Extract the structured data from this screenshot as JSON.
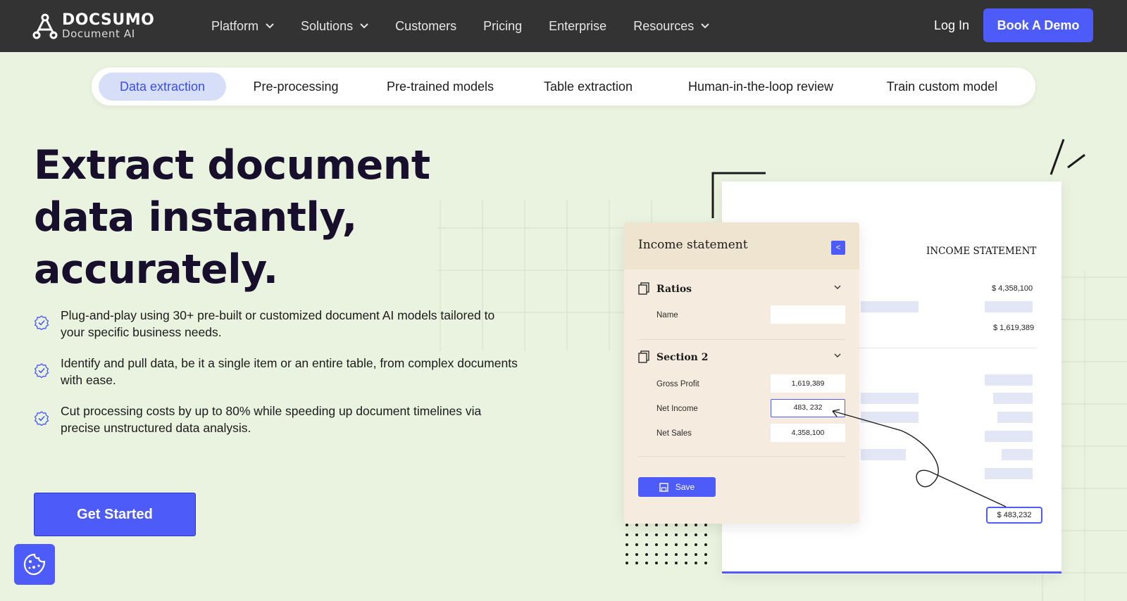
{
  "brand": {
    "name": "DOCSUMO",
    "subtitle": "Document AI"
  },
  "nav": {
    "items": [
      {
        "label": "Platform",
        "has_dropdown": true
      },
      {
        "label": "Solutions",
        "has_dropdown": true
      },
      {
        "label": "Customers",
        "has_dropdown": false
      },
      {
        "label": "Pricing",
        "has_dropdown": false
      },
      {
        "label": "Enterprise",
        "has_dropdown": false
      },
      {
        "label": "Resources",
        "has_dropdown": true
      }
    ],
    "login_label": "Log In",
    "demo_label": "Book A Demo"
  },
  "tabs": [
    {
      "label": "Data extraction",
      "active": true
    },
    {
      "label": "Pre-processing",
      "active": false
    },
    {
      "label": "Pre-trained models",
      "active": false
    },
    {
      "label": "Table extraction",
      "active": false
    },
    {
      "label": "Human-in-the-loop review",
      "active": false
    },
    {
      "label": "Train custom model",
      "active": false
    }
  ],
  "hero": {
    "title_lines": [
      "Extract document",
      "data instantly,",
      "accurately."
    ],
    "bullets": [
      "Plug-and-play using 30+ pre-built or customized document AI models tailored to your specific business needs.",
      "Identify and pull data, be it a single item or an entire table, from complex documents with ease.",
      "Cut processing costs by up to 80% while speeding up document timelines via precise unstructured data analysis."
    ],
    "cta_label": "Get Started"
  },
  "illustration": {
    "panel_title": "Income statement",
    "collapse_glyph": "<",
    "sections": [
      {
        "title": "Ratios",
        "fields": [
          {
            "label": "Name",
            "value": ""
          }
        ]
      },
      {
        "title": "Section 2",
        "fields": [
          {
            "label": "Gross Profit",
            "value": "1,619,389"
          },
          {
            "label": "Net Income",
            "value": "483, 232"
          },
          {
            "label": "Net Sales",
            "value": "4,358,100"
          }
        ]
      }
    ],
    "save_label": "Save",
    "document": {
      "title": "INCOME STATEMENT",
      "amount_1": "$ 4,358,100",
      "amount_2": "$ 1,619,389",
      "highlight": "$ 483,232"
    }
  },
  "colors": {
    "accent": "#4d5bf9",
    "nav_bg": "#333333",
    "page_bg": "#eaf3df",
    "tab_active_bg": "#d7def8"
  },
  "icons": [
    "docsumo-logo-icon",
    "chevron-down-icon",
    "verified-badge-icon",
    "cookie-icon",
    "document-icon",
    "chevron-left-icon",
    "save-icon"
  ]
}
